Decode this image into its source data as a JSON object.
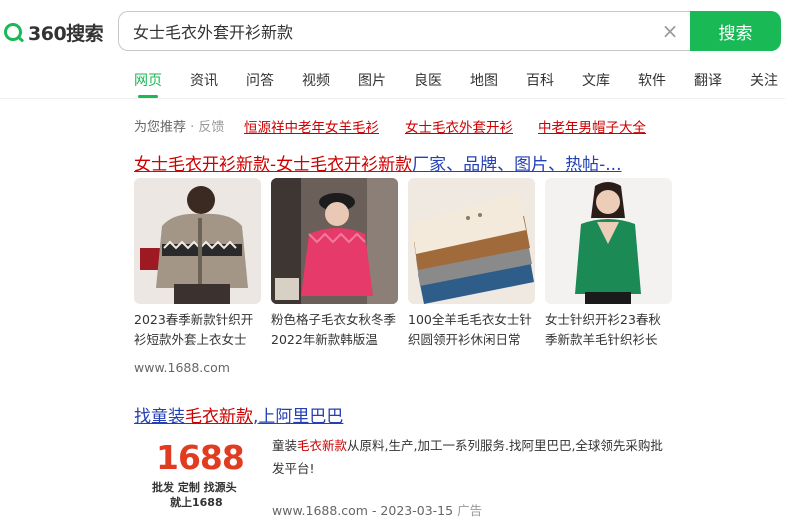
{
  "brand": {
    "name": "360搜索",
    "accent": "#19b955"
  },
  "search": {
    "query": "女士毛衣外套开衫新款",
    "button_label": "搜索"
  },
  "tabs": [
    {
      "label": "网页",
      "active": true
    },
    {
      "label": "资讯"
    },
    {
      "label": "问答"
    },
    {
      "label": "视频"
    },
    {
      "label": "图片"
    },
    {
      "label": "良医"
    },
    {
      "label": "地图"
    },
    {
      "label": "百科"
    },
    {
      "label": "文库"
    },
    {
      "label": "软件"
    },
    {
      "label": "翻译"
    },
    {
      "label": "关注"
    }
  ],
  "recommend": {
    "label": "为您推荐",
    "feedback": "· 反馈",
    "links": [
      "恒源祥中老年女羊毛衫",
      "女士毛衣外套开衫",
      "中老年男帽子大全"
    ]
  },
  "result1": {
    "title_hl": "女士毛衣开衫新款-女士毛衣开衫新款",
    "title_rest": "厂家、品牌、图片、热帖-...",
    "items": [
      {
        "caption": "2023春季新款针织开衫短款外套上衣女士"
      },
      {
        "caption": "粉色格子毛衣女秋冬季2022年新款韩版温"
      },
      {
        "caption": "100全羊毛毛衣女士针织圆领开衫休闲日常"
      },
      {
        "caption": "女士针织开衫23春秋季新款羊毛针织衫长"
      }
    ],
    "url": "www.1688.com"
  },
  "result2": {
    "title_a": "找童装",
    "title_b": "毛衣新款",
    "title_c": ",上阿里巴巴",
    "logo_big": "1688",
    "logo_sub1": "批发 定制 找源头",
    "logo_sub2": "就上1688",
    "desc_a": "童装",
    "desc_b": "毛衣新款",
    "desc_c": "从原料,生产,加工一系列服务.找阿里巴巴,全球领先采购批发平台!",
    "url": "www.1688.com - 2023-03-15",
    "ad": "广告"
  }
}
